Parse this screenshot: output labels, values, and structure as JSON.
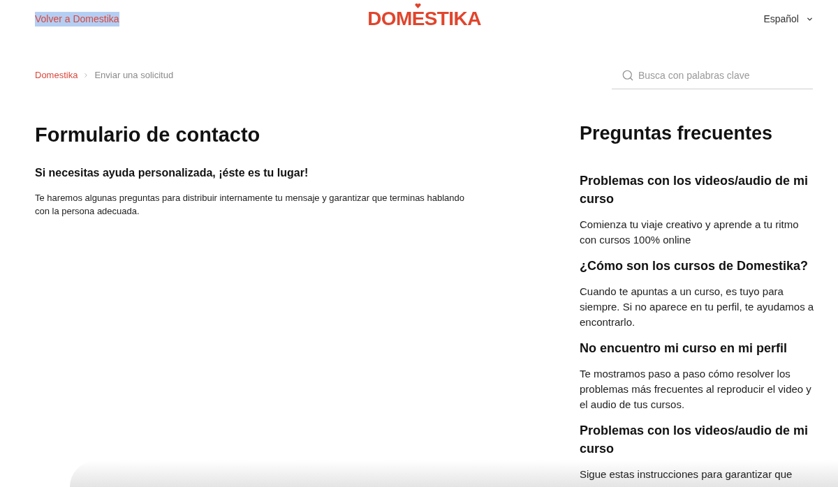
{
  "header": {
    "back_link": {
      "text": "Volver a Domestika",
      "highlighted": true
    },
    "logo": "DOMESTIKA",
    "language": "Español"
  },
  "breadcrumb": [
    {
      "text": "Domestika",
      "kind": "link"
    },
    {
      "text": "Enviar una solicitud",
      "kind": "current"
    }
  ],
  "search": {
    "placeholder": "Busca con palabras clave"
  },
  "contact": {
    "title": "Formulario de contacto",
    "subtitle": "Si necesitas ayuda personalizada, ¡éste es tu lugar!",
    "description": "Te haremos algunas preguntas para distribuir internamente tu mensaje y garantizar que terminas hablando con la persona adecuada."
  },
  "faq": {
    "title": "Preguntas frecuentes",
    "items": [
      {
        "question": "Problemas con los videos/audio de mi curso",
        "answer": "Comienza tu viaje creativo y aprende a tu ritmo con cursos 100% online"
      },
      {
        "question": "¿Cómo son los cursos de Domestika?",
        "answer": "Cuando te apuntas a un curso, es tuyo para siempre. Si no aparece en tu perfil, te ayudamos a encontrarlo."
      },
      {
        "question": "No encuentro mi curso en mi perfil",
        "answer": "Te mostramos paso a paso cómo resolver los problemas más frecuentes al reproducir el video y el audio de tus cursos."
      },
      {
        "question": "Problemas con los videos/audio de mi curso",
        "answer": "Sigue estas instrucciones para garantizar que"
      }
    ]
  }
}
